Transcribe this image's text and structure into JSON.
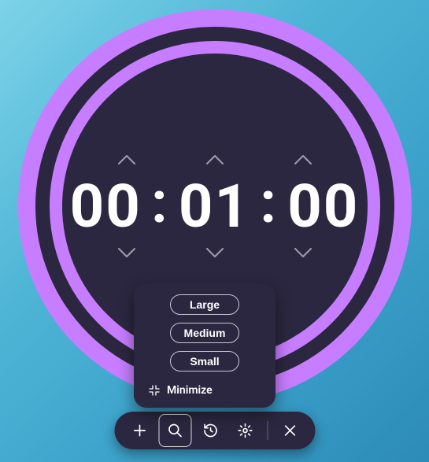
{
  "timer": {
    "hours": "00",
    "minutes": "01",
    "seconds": "00",
    "separator": ":"
  },
  "sizeMenu": {
    "options": {
      "large": "Large",
      "medium": "Medium",
      "small": "Small"
    },
    "minimize_label": "Minimize"
  },
  "colors": {
    "accent": "#c77dff",
    "face": "#2b2740"
  },
  "toolbar": {
    "active_index": 1
  }
}
